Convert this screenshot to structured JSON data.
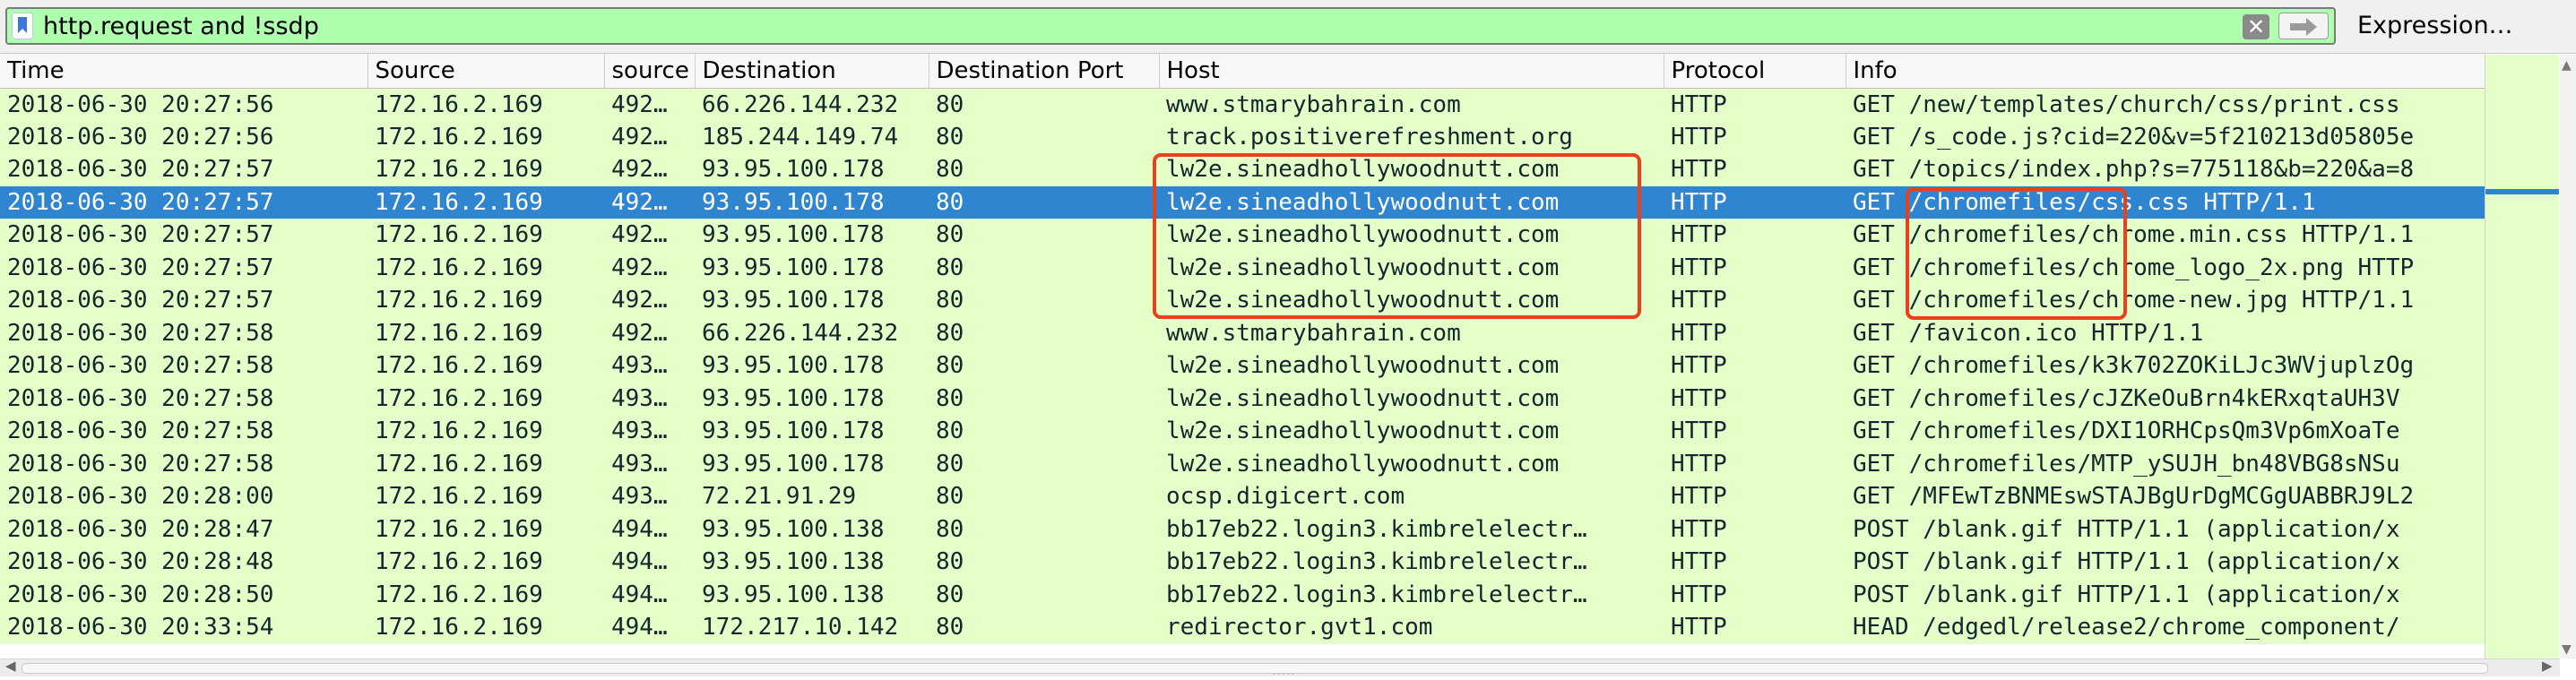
{
  "filter": {
    "value": "http.request and !ssdp",
    "bookmark_icon": "bookmark-icon",
    "clear_icon": "clear-x-icon",
    "clear_glyph": "✕",
    "apply_icon": "arrow-right-icon",
    "expression_label": "Expression…"
  },
  "columns": [
    "Time",
    "Source",
    "source",
    "Destination",
    "Destination Port",
    "Host",
    "Protocol",
    "Info"
  ],
  "packets": [
    {
      "time": "2018-06-30 20:27:56",
      "src": "172.16.2.169",
      "sport": "492…",
      "dst": "66.226.144.232",
      "dport": "80",
      "host": "www.stmarybahrain.com",
      "proto": "HTTP",
      "info": "GET /new/templates/church/css/print.css"
    },
    {
      "time": "2018-06-30 20:27:56",
      "src": "172.16.2.169",
      "sport": "492…",
      "dst": "185.244.149.74",
      "dport": "80",
      "host": "track.positiverefreshment.org",
      "proto": "HTTP",
      "info": "GET /s_code.js?cid=220&v=5f210213d05805e"
    },
    {
      "time": "2018-06-30 20:27:57",
      "src": "172.16.2.169",
      "sport": "492…",
      "dst": "93.95.100.178",
      "dport": "80",
      "host": "lw2e.sineadhollywoodnutt.com",
      "proto": "HTTP",
      "info": "GET /topics/index.php?s=775118&b=220&a=8"
    },
    {
      "time": "2018-06-30 20:27:57",
      "src": "172.16.2.169",
      "sport": "492…",
      "dst": "93.95.100.178",
      "dport": "80",
      "host": "lw2e.sineadhollywoodnutt.com",
      "proto": "HTTP",
      "info": "GET /chromefiles/css.css HTTP/1.1",
      "selected": true
    },
    {
      "time": "2018-06-30 20:27:57",
      "src": "172.16.2.169",
      "sport": "492…",
      "dst": "93.95.100.178",
      "dport": "80",
      "host": "lw2e.sineadhollywoodnutt.com",
      "proto": "HTTP",
      "info": "GET /chromefiles/chrome.min.css HTTP/1.1"
    },
    {
      "time": "2018-06-30 20:27:57",
      "src": "172.16.2.169",
      "sport": "492…",
      "dst": "93.95.100.178",
      "dport": "80",
      "host": "lw2e.sineadhollywoodnutt.com",
      "proto": "HTTP",
      "info": "GET /chromefiles/chrome_logo_2x.png HTTP"
    },
    {
      "time": "2018-06-30 20:27:57",
      "src": "172.16.2.169",
      "sport": "492…",
      "dst": "93.95.100.178",
      "dport": "80",
      "host": "lw2e.sineadhollywoodnutt.com",
      "proto": "HTTP",
      "info": "GET /chromefiles/chrome-new.jpg HTTP/1.1"
    },
    {
      "time": "2018-06-30 20:27:58",
      "src": "172.16.2.169",
      "sport": "492…",
      "dst": "66.226.144.232",
      "dport": "80",
      "host": "www.stmarybahrain.com",
      "proto": "HTTP",
      "info": "GET /favicon.ico HTTP/1.1"
    },
    {
      "time": "2018-06-30 20:27:58",
      "src": "172.16.2.169",
      "sport": "493…",
      "dst": "93.95.100.178",
      "dport": "80",
      "host": "lw2e.sineadhollywoodnutt.com",
      "proto": "HTTP",
      "info": "GET /chromefiles/k3k702ZOKiLJc3WVjuplzOg"
    },
    {
      "time": "2018-06-30 20:27:58",
      "src": "172.16.2.169",
      "sport": "493…",
      "dst": "93.95.100.178",
      "dport": "80",
      "host": "lw2e.sineadhollywoodnutt.com",
      "proto": "HTTP",
      "info": "GET /chromefiles/cJZKeOuBrn4kERxqtaUH3V"
    },
    {
      "time": "2018-06-30 20:27:58",
      "src": "172.16.2.169",
      "sport": "493…",
      "dst": "93.95.100.178",
      "dport": "80",
      "host": "lw2e.sineadhollywoodnutt.com",
      "proto": "HTTP",
      "info": "GET /chromefiles/DXI1ORHCpsQm3Vp6mXoaTe"
    },
    {
      "time": "2018-06-30 20:27:58",
      "src": "172.16.2.169",
      "sport": "493…",
      "dst": "93.95.100.178",
      "dport": "80",
      "host": "lw2e.sineadhollywoodnutt.com",
      "proto": "HTTP",
      "info": "GET /chromefiles/MTP_ySUJH_bn48VBG8sNSu"
    },
    {
      "time": "2018-06-30 20:28:00",
      "src": "172.16.2.169",
      "sport": "493…",
      "dst": "72.21.91.29",
      "dport": "80",
      "host": "ocsp.digicert.com",
      "proto": "HTTP",
      "info": "GET /MFEwTzBNMEswSTAJBgUrDgMCGgUABBRJ9L2"
    },
    {
      "time": "2018-06-30 20:28:47",
      "src": "172.16.2.169",
      "sport": "494…",
      "dst": "93.95.100.138",
      "dport": "80",
      "host": "bb17eb22.login3.kimbrelelectr…",
      "proto": "HTTP",
      "info": "POST /blank.gif HTTP/1.1  (application/x"
    },
    {
      "time": "2018-06-30 20:28:48",
      "src": "172.16.2.169",
      "sport": "494…",
      "dst": "93.95.100.138",
      "dport": "80",
      "host": "bb17eb22.login3.kimbrelelectr…",
      "proto": "HTTP",
      "info": "POST /blank.gif HTTP/1.1  (application/x"
    },
    {
      "time": "2018-06-30 20:28:50",
      "src": "172.16.2.169",
      "sport": "494…",
      "dst": "93.95.100.138",
      "dport": "80",
      "host": "bb17eb22.login3.kimbrelelectr…",
      "proto": "HTTP",
      "info": "POST /blank.gif HTTP/1.1  (application/x"
    },
    {
      "time": "2018-06-30 20:33:54",
      "src": "172.16.2.169",
      "sport": "494…",
      "dst": "172.217.10.142",
      "dport": "80",
      "host": "redirector.gvt1.com",
      "proto": "HTTP",
      "info": "HEAD /edgedl/release2/chrome_component/"
    }
  ],
  "colors": {
    "row_background": "#e4ffc7",
    "selected_row": "#3085d0",
    "filter_valid": "#afffaf",
    "highlight_box": "#e8421c",
    "text": "#12272e"
  },
  "scroll": {
    "up_icon": "scroll-up-arrow-icon",
    "down_icon": "scroll-down-arrow-icon",
    "left_icon": "scroll-left-arrow-icon",
    "right_icon": "scroll-right-arrow-icon"
  }
}
